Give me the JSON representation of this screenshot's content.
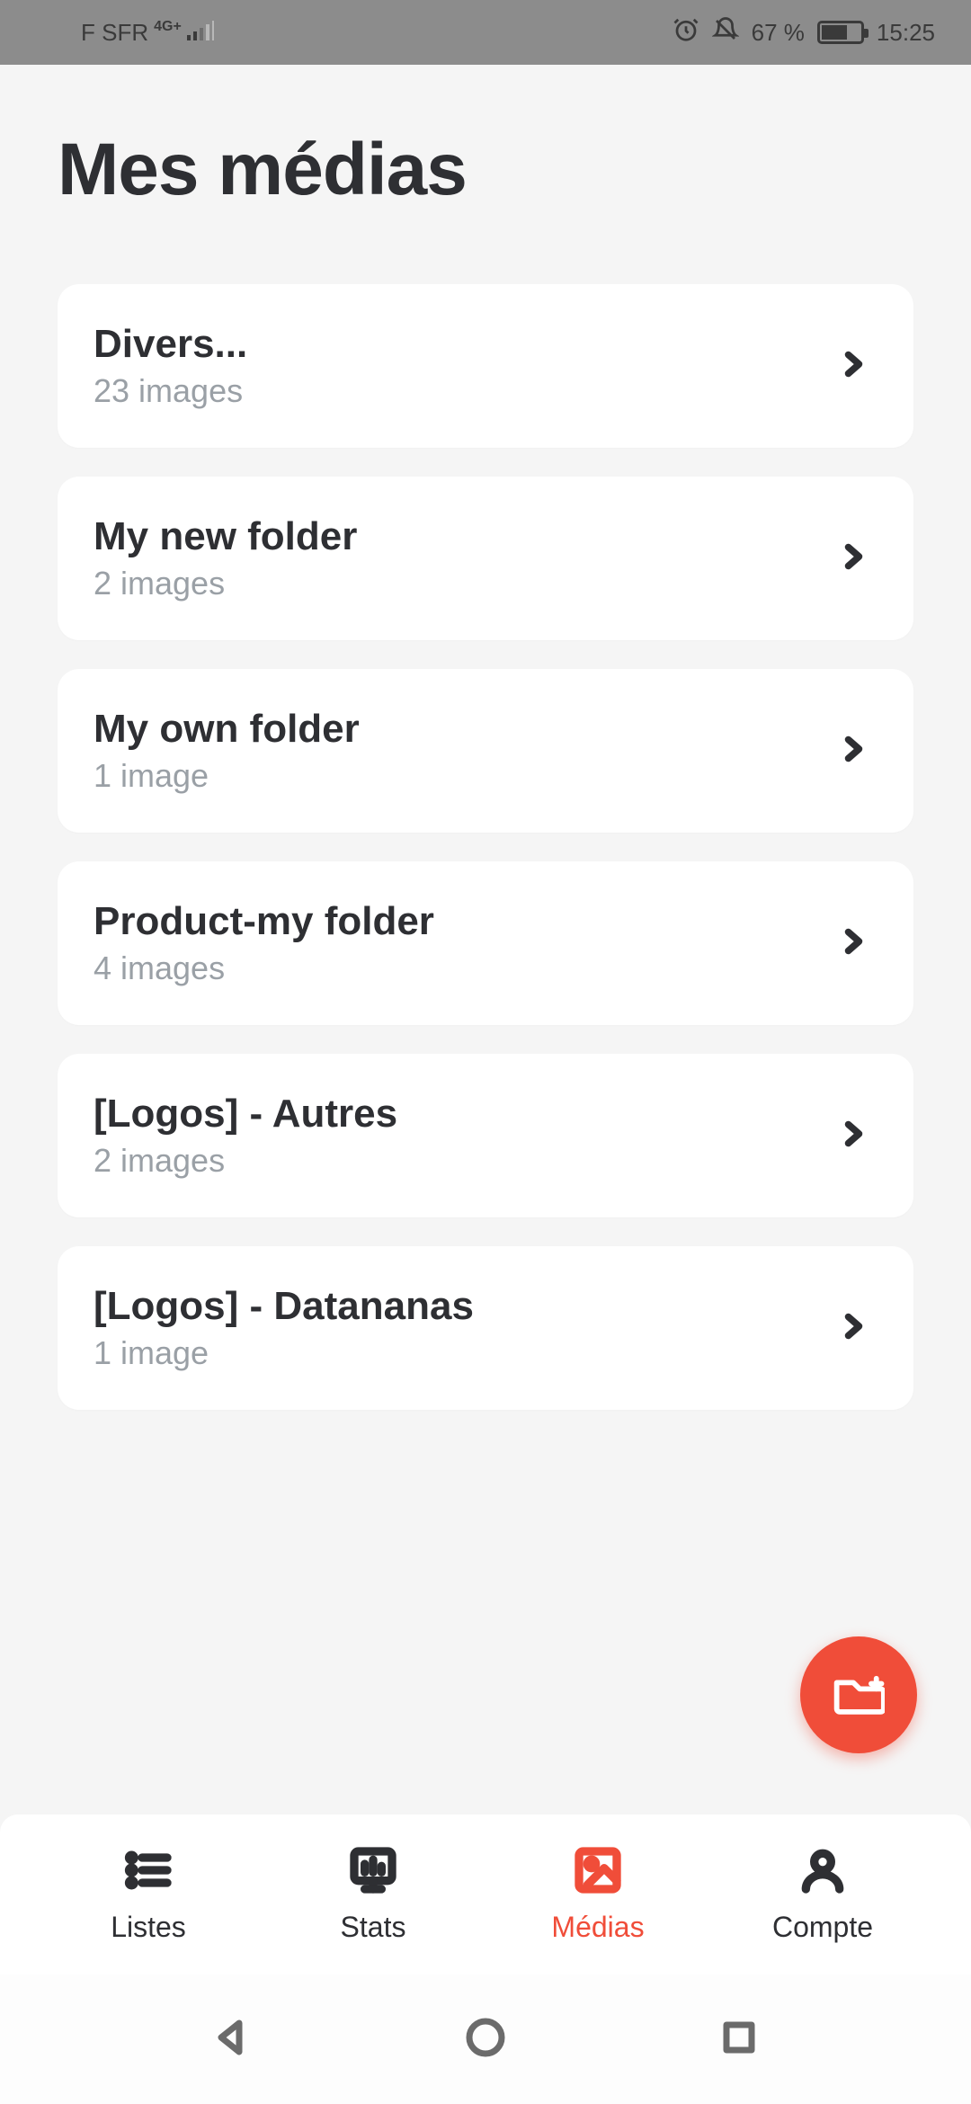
{
  "status": {
    "carrier": "F SFR",
    "network": "4G+",
    "battery_pct": "67 %",
    "time": "15:25"
  },
  "page": {
    "title": "Mes médias"
  },
  "folders": [
    {
      "name": "Divers...",
      "count": "23 images"
    },
    {
      "name": "My new folder",
      "count": "2 images"
    },
    {
      "name": "My own folder",
      "count": "1 image"
    },
    {
      "name": "Product-my folder",
      "count": "4 images"
    },
    {
      "name": "[Logos] - Autres",
      "count": "2 images"
    },
    {
      "name": "[Logos] - Datananas",
      "count": "1 image"
    }
  ],
  "nav": {
    "items": [
      {
        "label": "Listes"
      },
      {
        "label": "Stats"
      },
      {
        "label": "Médias"
      },
      {
        "label": "Compte"
      }
    ],
    "active_index": 2
  },
  "colors": {
    "accent": "#f04d39",
    "text": "#2e2f33",
    "muted": "#9aa0a6",
    "bg": "#f5f5f5"
  }
}
